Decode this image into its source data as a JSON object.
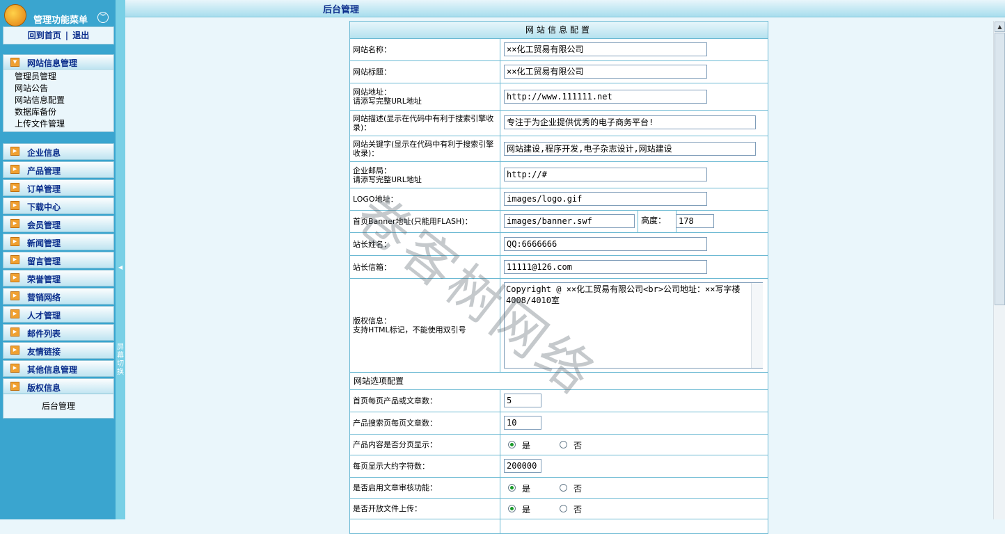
{
  "sidebar": {
    "menu_title": "管理功能菜单",
    "links": {
      "home": "回到首页",
      "sep": "|",
      "logout": "退出"
    },
    "site_panel": {
      "title": "网站信息管理",
      "items": [
        "管理员管理",
        "网站公告",
        "网站信息配置",
        "数据库备份",
        "上传文件管理"
      ]
    },
    "menu": [
      "企业信息",
      "产品管理",
      "订单管理",
      "下载中心",
      "会员管理",
      "新闻管理",
      "留言管理",
      "荣誉管理",
      "营销网络",
      "人才管理",
      "邮件列表",
      "友情链接",
      "其他信息管理",
      "版权信息"
    ],
    "bottom": "后台管理"
  },
  "splitter": {
    "text": "屏幕切换"
  },
  "header": {
    "title": "后台管理"
  },
  "form": {
    "title": "网站信息配置",
    "site_name": {
      "label": "网站名称：",
      "value": "××化工贸易有限公司"
    },
    "site_title": {
      "label": "网站标题：",
      "value": "××化工贸易有限公司"
    },
    "site_url": {
      "label1": "网站地址：",
      "label2": "请添写完整URL地址",
      "value": "http://www.111111.net"
    },
    "description": {
      "label": "网站描述(显示在代码中有利于搜索引擎收录)：",
      "value": "专注于为企业提供优秀的电子商务平台!"
    },
    "keywords": {
      "label": "网站关键字(显示在代码中有利于搜索引擎收录)：",
      "value": "网站建设,程序开发,电子杂志设计,网站建设"
    },
    "email": {
      "label1": "企业邮局：",
      "label2": "请添写完整URL地址",
      "value": "http://#"
    },
    "logo": {
      "label": "LOGO地址：",
      "value": "images/logo.gif"
    },
    "banner": {
      "label": "首页Banner地址(只能用FLASH)：",
      "value": "images/banner.swf",
      "height_label": "高度：",
      "height_value": "178"
    },
    "owner_name": {
      "label": "站长姓名：",
      "value": "QQ:6666666"
    },
    "owner_mail": {
      "label": "站长信箱：",
      "value": "11111@126.com"
    },
    "copyright": {
      "label1": "版权信息：",
      "label2": "支持HTML标记，不能使用双引号",
      "value": "Copyright @ ××化工贸易有限公司<br>公司地址：××写字楼4008/4010室"
    },
    "options_title": "网站选项配置",
    "per_page": {
      "label": "首页每页产品或文章数：",
      "value": "5"
    },
    "search_per_page": {
      "label": "产品搜索页每页文章数：",
      "value": "10"
    },
    "paged": {
      "label": "产品内容是否分页显示：",
      "yes": "是",
      "no": "否"
    },
    "chars_per_page": {
      "label": "每页显示大约字符数：",
      "value": "200000"
    },
    "audit": {
      "label": "是否启用文章审核功能：",
      "yes": "是",
      "no": "否"
    },
    "upload": {
      "label": "是否开放文件上传：",
      "yes": "是",
      "no": "否"
    }
  },
  "watermark": "卷客树网络"
}
